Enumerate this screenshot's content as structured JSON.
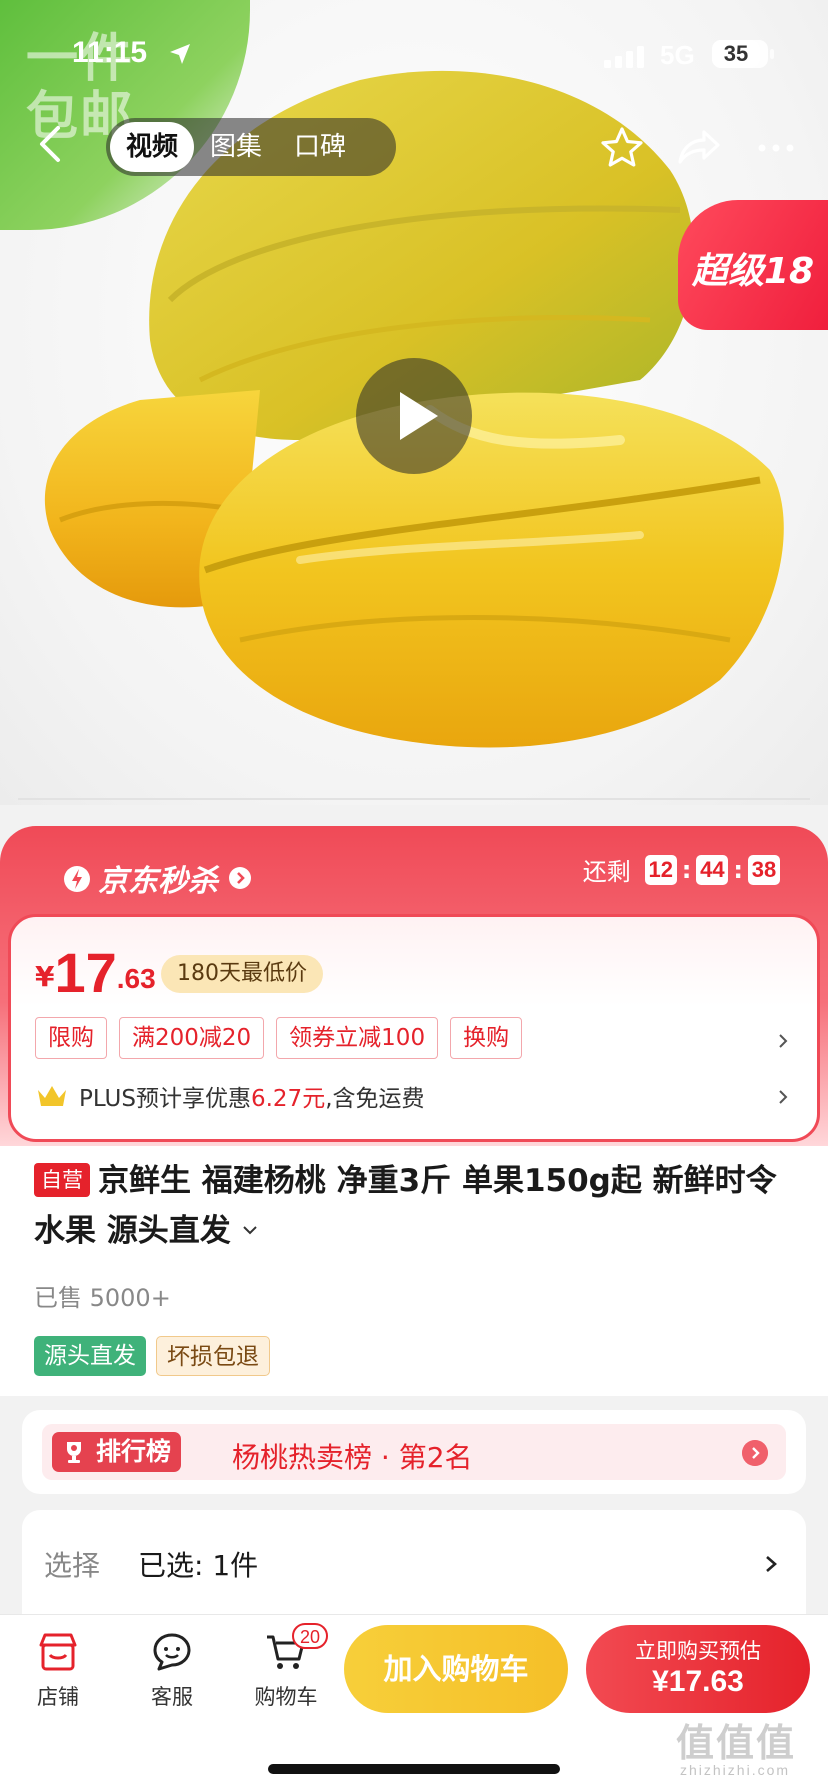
{
  "status_bar": {
    "time": "11:15",
    "network": "5G",
    "battery": "35"
  },
  "hero": {
    "corner_badge": "一件\n包邮",
    "tabs": [
      "视频",
      "图集",
      "口碑"
    ],
    "active_tab": 0,
    "super_badge": "超级18"
  },
  "flash_sale": {
    "brand": "京东秒杀",
    "countdown_label": "还剩",
    "countdown": {
      "h": "12",
      "m": "44",
      "s": "38"
    }
  },
  "price": {
    "currency": "¥",
    "integer": "17",
    "decimal": ".63",
    "low_tag": "180天最低价",
    "promos": [
      "限购",
      "满200减20",
      "领券立减100",
      "换购"
    ],
    "plus_prefix": "PLUS预计享优惠",
    "plus_amount": "6.27元",
    "plus_suffix": ",含免运费"
  },
  "product": {
    "self_tag": "自营",
    "title": "京鲜生 福建杨桃 净重3斤 单果150g起 新鲜时令水果 源头直发",
    "sold": "已售 5000+",
    "tags": [
      "源头直发",
      "坏损包退"
    ]
  },
  "ranking": {
    "badge": "排行榜",
    "text": "杨桃热卖榜 · 第2名"
  },
  "selection": {
    "label": "选择",
    "value": "已选:  1件"
  },
  "bottom_bar": {
    "shop": "店铺",
    "service": "客服",
    "cart": "购物车",
    "cart_count": "20",
    "add_to_cart": "加入购物车",
    "buy_now_line1": "立即购买预估",
    "buy_now_line2": "¥17.63"
  },
  "watermark": {
    "text": "值值值",
    "sub": "zhizhizhi.com"
  },
  "colors": {
    "brand_red": "#e5222b",
    "cart_yellow": "#f5bf28",
    "green_tag": "#3fb27a"
  }
}
